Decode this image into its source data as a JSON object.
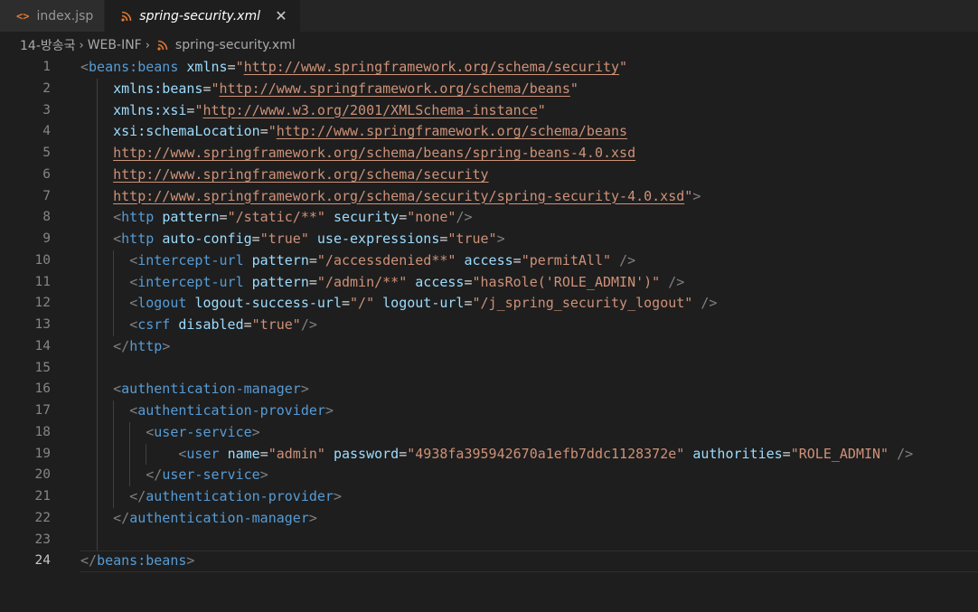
{
  "tabs": [
    {
      "label": "index.jsp",
      "icon": "jsp-file-icon",
      "active": false
    },
    {
      "label": "spring-security.xml",
      "icon": "xml-file-icon",
      "active": true,
      "close": "✕"
    }
  ],
  "breadcrumb": {
    "items": [
      "14-방송국",
      "WEB-INF",
      "spring-security.xml"
    ],
    "separator": "›"
  },
  "editor": {
    "current_line": 24,
    "line_numbers": [
      "1",
      "2",
      "3",
      "4",
      "5",
      "6",
      "7",
      "8",
      "9",
      "10",
      "11",
      "12",
      "13",
      "14",
      "15",
      "16",
      "17",
      "18",
      "19",
      "20",
      "21",
      "22",
      "23",
      "24"
    ],
    "lines": [
      [
        [
          "t",
          "<"
        ],
        [
          "tn",
          "beans:beans"
        ],
        [
          "sp",
          " "
        ],
        [
          "an",
          "xmlns"
        ],
        [
          "eq",
          "="
        ],
        [
          "sv",
          "\"",
          "http://www.springframework.org/schema/security",
          "\""
        ]
      ],
      [
        [
          "sp",
          "    "
        ],
        [
          "an",
          "xmlns:beans"
        ],
        [
          "eq",
          "="
        ],
        [
          "sv",
          "\"",
          "http://www.springframework.org/schema/beans",
          "\""
        ]
      ],
      [
        [
          "sp",
          "    "
        ],
        [
          "an",
          "xmlns:xsi"
        ],
        [
          "eq",
          "="
        ],
        [
          "sv",
          "\"",
          "http://www.w3.org/2001/XMLSchema-instance",
          "\""
        ]
      ],
      [
        [
          "sp",
          "    "
        ],
        [
          "an",
          "xsi:schemaLocation"
        ],
        [
          "eq",
          "="
        ],
        [
          "sv",
          "\"",
          "http://www.springframework.org/schema/beans",
          ""
        ]
      ],
      [
        [
          "sp",
          "    "
        ],
        [
          "sv",
          "",
          "http://www.springframework.org/schema/beans/spring-beans-4.0.xsd",
          ""
        ]
      ],
      [
        [
          "sp",
          "    "
        ],
        [
          "sv",
          "",
          "http://www.springframework.org/schema/security",
          ""
        ]
      ],
      [
        [
          "sp",
          "    "
        ],
        [
          "sv",
          "",
          "http://www.springframework.org/schema/security/spring-security-4.0.xsd",
          "\""
        ],
        [
          "t",
          ">"
        ]
      ],
      [
        [
          "sp",
          "    "
        ],
        [
          "t",
          "<"
        ],
        [
          "tn",
          "http"
        ],
        [
          "sp",
          " "
        ],
        [
          "an",
          "pattern"
        ],
        [
          "eq",
          "="
        ],
        [
          "sv",
          "\"/static/**\""
        ],
        [
          "sp",
          " "
        ],
        [
          "an",
          "security"
        ],
        [
          "eq",
          "="
        ],
        [
          "sv",
          "\"none\""
        ],
        [
          "t",
          "/>"
        ]
      ],
      [
        [
          "sp",
          "    "
        ],
        [
          "t",
          "<"
        ],
        [
          "tn",
          "http"
        ],
        [
          "sp",
          " "
        ],
        [
          "an",
          "auto-config"
        ],
        [
          "eq",
          "="
        ],
        [
          "sv",
          "\"true\""
        ],
        [
          "sp",
          " "
        ],
        [
          "an",
          "use-expressions"
        ],
        [
          "eq",
          "="
        ],
        [
          "sv",
          "\"true\""
        ],
        [
          "t",
          ">"
        ]
      ],
      [
        [
          "sp",
          "      "
        ],
        [
          "t",
          "<"
        ],
        [
          "tn",
          "intercept-url"
        ],
        [
          "sp",
          " "
        ],
        [
          "an",
          "pattern"
        ],
        [
          "eq",
          "="
        ],
        [
          "sv",
          "\"/accessdenied**\""
        ],
        [
          "sp",
          " "
        ],
        [
          "an",
          "access"
        ],
        [
          "eq",
          "="
        ],
        [
          "sv",
          "\"permitAll\""
        ],
        [
          "sp",
          " "
        ],
        [
          "t",
          "/>"
        ]
      ],
      [
        [
          "sp",
          "      "
        ],
        [
          "t",
          "<"
        ],
        [
          "tn",
          "intercept-url"
        ],
        [
          "sp",
          " "
        ],
        [
          "an",
          "pattern"
        ],
        [
          "eq",
          "="
        ],
        [
          "sv",
          "\"/admin/**\""
        ],
        [
          "sp",
          " "
        ],
        [
          "an",
          "access"
        ],
        [
          "eq",
          "="
        ],
        [
          "sv",
          "\"hasRole('ROLE_ADMIN')\""
        ],
        [
          "sp",
          " "
        ],
        [
          "t",
          "/>"
        ]
      ],
      [
        [
          "sp",
          "      "
        ],
        [
          "t",
          "<"
        ],
        [
          "tn",
          "logout"
        ],
        [
          "sp",
          " "
        ],
        [
          "an",
          "logout-success-url"
        ],
        [
          "eq",
          "="
        ],
        [
          "sv",
          "\"/\""
        ],
        [
          "sp",
          " "
        ],
        [
          "an",
          "logout-url"
        ],
        [
          "eq",
          "="
        ],
        [
          "sv",
          "\"/j_spring_security_logout\""
        ],
        [
          "sp",
          " "
        ],
        [
          "t",
          "/>"
        ]
      ],
      [
        [
          "sp",
          "      "
        ],
        [
          "t",
          "<"
        ],
        [
          "tn",
          "csrf"
        ],
        [
          "sp",
          " "
        ],
        [
          "an",
          "disabled"
        ],
        [
          "eq",
          "="
        ],
        [
          "sv",
          "\"true\""
        ],
        [
          "t",
          "/>"
        ]
      ],
      [
        [
          "sp",
          "    "
        ],
        [
          "t",
          "</"
        ],
        [
          "tn",
          "http"
        ],
        [
          "t",
          ">"
        ]
      ],
      [],
      [
        [
          "sp",
          "    "
        ],
        [
          "t",
          "<"
        ],
        [
          "tn",
          "authentication-manager"
        ],
        [
          "t",
          ">"
        ]
      ],
      [
        [
          "sp",
          "      "
        ],
        [
          "t",
          "<"
        ],
        [
          "tn",
          "authentication-provider"
        ],
        [
          "t",
          ">"
        ]
      ],
      [
        [
          "sp",
          "        "
        ],
        [
          "t",
          "<"
        ],
        [
          "tn",
          "user-service"
        ],
        [
          "t",
          ">"
        ]
      ],
      [
        [
          "sp",
          "            "
        ],
        [
          "t",
          "<"
        ],
        [
          "tn",
          "user"
        ],
        [
          "sp",
          " "
        ],
        [
          "an",
          "name"
        ],
        [
          "eq",
          "="
        ],
        [
          "sv",
          "\"admin\""
        ],
        [
          "sp",
          " "
        ],
        [
          "an",
          "password"
        ],
        [
          "eq",
          "="
        ],
        [
          "sv",
          "\"4938fa395942670a1efb7ddc1128372e\""
        ],
        [
          "sp",
          " "
        ],
        [
          "an",
          "authorities"
        ],
        [
          "eq",
          "="
        ],
        [
          "sv",
          "\"ROLE_ADMIN\""
        ],
        [
          "sp",
          " "
        ],
        [
          "t",
          "/>"
        ]
      ],
      [
        [
          "sp",
          "        "
        ],
        [
          "t",
          "</"
        ],
        [
          "tn",
          "user-service"
        ],
        [
          "t",
          ">"
        ]
      ],
      [
        [
          "sp",
          "      "
        ],
        [
          "t",
          "</"
        ],
        [
          "tn",
          "authentication-provider"
        ],
        [
          "t",
          ">"
        ]
      ],
      [
        [
          "sp",
          "    "
        ],
        [
          "t",
          "</"
        ],
        [
          "tn",
          "authentication-manager"
        ],
        [
          "t",
          ">"
        ]
      ],
      [],
      [
        [
          "t",
          "</"
        ],
        [
          "tn",
          "beans:beans"
        ],
        [
          "t",
          ">"
        ]
      ]
    ]
  },
  "colors": {
    "background": "#1e1e1e",
    "tag": "#569cd6",
    "attribute": "#9cdcfe",
    "string": "#ce9178",
    "punctuation": "#808080"
  }
}
